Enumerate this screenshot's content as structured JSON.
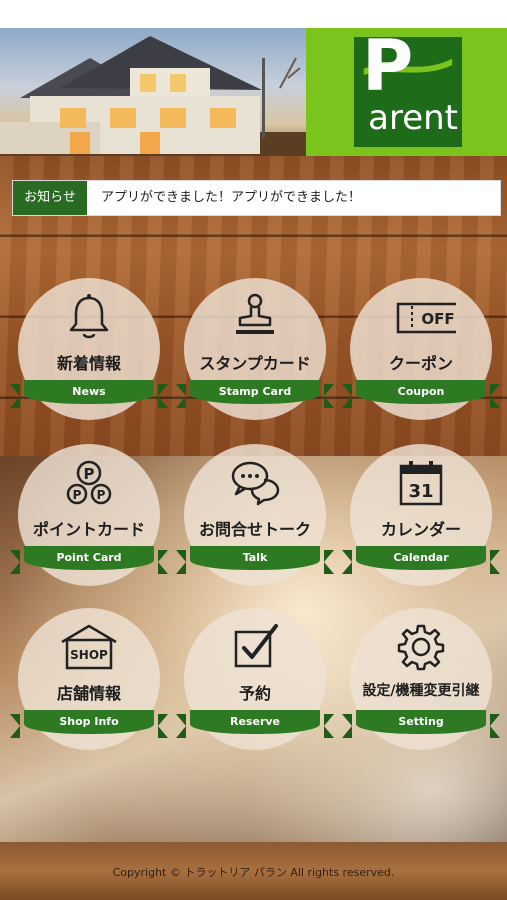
{
  "header": {
    "logo": {
      "initial": "P",
      "rest": "arent"
    }
  },
  "notice": {
    "label": "お知らせ",
    "text": "アプリができました！アプリができました！"
  },
  "menu": [
    {
      "jp": "新着情報",
      "en": "News",
      "icon": "bell-icon"
    },
    {
      "jp": "スタンプカード",
      "en": "Stamp Card",
      "icon": "stamp-icon"
    },
    {
      "jp": "クーポン",
      "en": "Coupon",
      "icon": "coupon-icon",
      "icon_text": "OFF"
    },
    {
      "jp": "ポイントカード",
      "en": "Point Card",
      "icon": "point-coins-icon",
      "icon_text": "P"
    },
    {
      "jp": "お問合せトーク",
      "en": "Talk",
      "icon": "chat-bubbles-icon"
    },
    {
      "jp": "カレンダー",
      "en": "Calendar",
      "icon": "calendar-icon",
      "icon_text": "31"
    },
    {
      "jp": "店舗情報",
      "en": "Shop Info",
      "icon": "shop-icon",
      "icon_text": "SHOP"
    },
    {
      "jp": "予約",
      "en": "Reserve",
      "icon": "checkbox-icon"
    },
    {
      "jp": "設定/機種変更引継",
      "en": "Setting",
      "icon": "gear-icon"
    }
  ],
  "footer": {
    "copyright": "Copyright © トラットリア パラン All rights reserved."
  },
  "colors": {
    "brand_green": "#2d7a22",
    "logo_green": "#7bc41d",
    "dark_green": "#1e6b1a"
  }
}
